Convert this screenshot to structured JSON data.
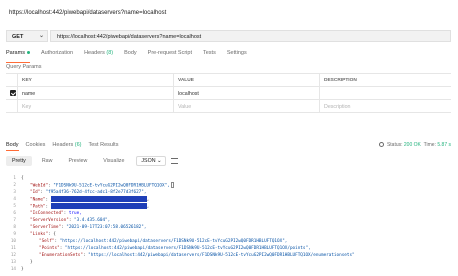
{
  "title": "https://localhost:442/piwebapi/dataservers?name=localhost",
  "request": {
    "method": "GET",
    "url": "https://localhost:442/piwebapi/dataservers?name=localhost"
  },
  "request_tabs": [
    {
      "label": "Params",
      "active": true,
      "dot": true
    },
    {
      "label": "Authorization"
    },
    {
      "label": "Headers",
      "count": "(8)"
    },
    {
      "label": "Body"
    },
    {
      "label": "Pre-request Script"
    },
    {
      "label": "Tests"
    },
    {
      "label": "Settings"
    }
  ],
  "query_params": {
    "title": "Query Params",
    "headers": {
      "key": "KEY",
      "value": "VALUE",
      "description": "DESCRIPTION"
    },
    "rows": [
      {
        "checked": true,
        "key": "name",
        "value": "localhost",
        "description": ""
      }
    ],
    "placeholder": {
      "key": "Key",
      "value": "Value",
      "description": "Description"
    }
  },
  "response_tabs": [
    {
      "label": "Body",
      "active": true
    },
    {
      "label": "Cookies"
    },
    {
      "label": "Headers",
      "count": "(6)"
    },
    {
      "label": "Test Results"
    }
  ],
  "status": {
    "label": "Status:",
    "code": "200 OK",
    "time_label": "Time:",
    "time": "5.87 s"
  },
  "formats": [
    "Pretty",
    "Raw",
    "Preview",
    "Visualize"
  ],
  "format_select": "JSON",
  "colors": {
    "accent": "#ff6c37",
    "success": "#26b47f",
    "redaction": "#1f3fb8"
  },
  "code_lines": [
    {
      "n": "1",
      "text": "{"
    },
    {
      "n": "2",
      "key": "\"WebId\"",
      "value": "\"F1DSNk9U-512cE-tvYcuG2PI2wQ0FDR1HBLUFTQ1OX\","
    },
    {
      "n": "3",
      "key": "\"Id\"",
      "value": "\"f95a4f36-762d-4fcc-adc1-8f2e77d3f627\","
    },
    {
      "n": "4",
      "key": "\"Name\"",
      "redacted": true
    },
    {
      "n": "5",
      "key": "\"Path\"",
      "redacted": true
    },
    {
      "n": "6",
      "key": "\"IsConnected\"",
      "value": "true,"
    },
    {
      "n": "7",
      "key": "\"ServerVersion\"",
      "value": "\"3.4.435.604\","
    },
    {
      "n": "8",
      "key": "\"ServerTime\"",
      "value": "\"2021-09-17T23:07:58.06526182\","
    },
    {
      "n": "9",
      "key": "\"Links\"",
      "value": "{"
    },
    {
      "n": "10",
      "key": "\"Self\"",
      "value": "\"https://localhost:442/piwebapi/dataservers/F1DSNk9U-512cE-tvYcuG2PI2wQ0FDR1HBLUFTQ1OX\","
    },
    {
      "n": "11",
      "key": "\"Points\"",
      "value": "\"https://localhost:442/piwebapi/dataservers/F1DSNk9U-512cE-tvYcuG2PI2wQ0FDR1HBLUFTQ1OX/points\","
    },
    {
      "n": "12",
      "key": "\"EnumerationSets\"",
      "value": "\"https://localhost:442/piwebapi/dataservers/F1DSNk9U-512cE-tvYcuG2PI2wQ0FDR1HBLUFTQ1OX/enumerationsets\""
    },
    {
      "n": "13",
      "text": "}"
    },
    {
      "n": "14",
      "text": "}"
    }
  ]
}
